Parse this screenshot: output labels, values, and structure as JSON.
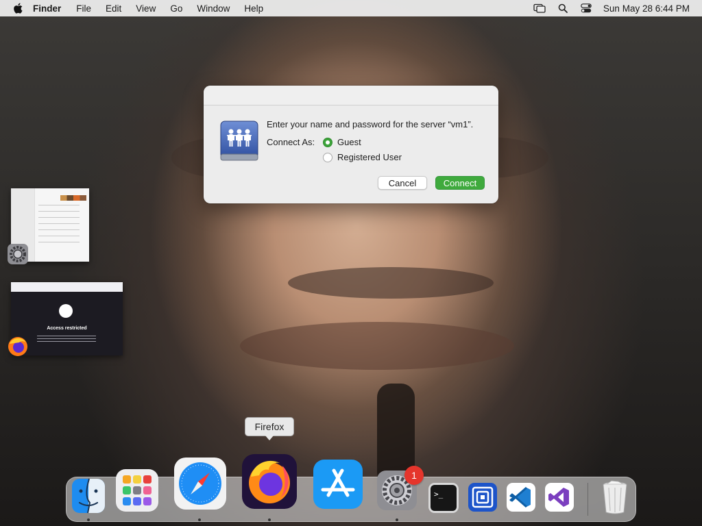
{
  "menubar": {
    "app_name": "Finder",
    "items": [
      "File",
      "Edit",
      "View",
      "Go",
      "Window",
      "Help"
    ],
    "clock": "Sun May 28  6:44 PM",
    "status_icons": [
      "screen-mirroring-icon",
      "search-icon",
      "control-center-icon"
    ]
  },
  "dialog": {
    "prompt": "Enter your name and password for the server “vm1”.",
    "connect_as_label": "Connect As:",
    "options": [
      {
        "label": "Guest",
        "selected": true
      },
      {
        "label": "Registered User",
        "selected": false
      }
    ],
    "cancel_label": "Cancel",
    "connect_label": "Connect",
    "accent_color": "#3faa3d"
  },
  "stage_manager": {
    "windows": [
      {
        "app": "System Settings",
        "icon": "gear-icon"
      },
      {
        "app": "Firefox",
        "icon": "firefox-icon",
        "caption": "Access restricted"
      }
    ]
  },
  "tooltip": {
    "label": "Firefox"
  },
  "dock": {
    "items": [
      {
        "name": "Finder",
        "icon": "finder-icon",
        "running": true
      },
      {
        "name": "Launchpad",
        "icon": "launchpad-icon",
        "running": false
      },
      {
        "name": "Safari",
        "icon": "safari-icon",
        "running": true
      },
      {
        "name": "Firefox",
        "icon": "firefox-icon",
        "running": true
      },
      {
        "name": "App Store",
        "icon": "app-store-icon",
        "running": false
      },
      {
        "name": "System Settings",
        "icon": "gear-icon",
        "running": true,
        "badge": "1"
      },
      {
        "name": "Terminal",
        "icon": "terminal-icon",
        "running": false
      },
      {
        "name": "Framer",
        "icon": "framer-icon",
        "running": false
      },
      {
        "name": "Visual Studio Code",
        "icon": "vscode-icon",
        "running": false
      },
      {
        "name": "Visual Studio",
        "icon": "visual-studio-icon",
        "running": false
      },
      {
        "name": "Trash",
        "icon": "trash-icon",
        "running": false
      }
    ]
  }
}
